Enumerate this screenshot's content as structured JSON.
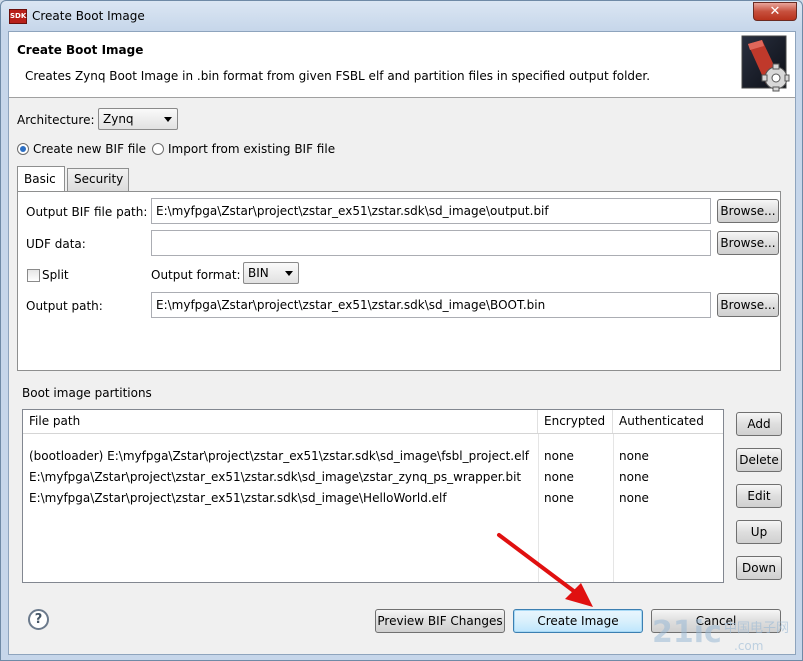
{
  "window": {
    "title": "Create Boot Image",
    "app_icon": "SDK",
    "close_glyph": "✕"
  },
  "banner": {
    "title": "Create Boot Image",
    "description": "Creates Zynq Boot Image in .bin format from given FSBL elf and partition files in specified output folder."
  },
  "architecture": {
    "label": "Architecture:",
    "value": "Zynq"
  },
  "mode": {
    "create_new": "Create new BIF file",
    "import_existing": "Import from existing BIF file",
    "selected": "create_new"
  },
  "tabs": [
    {
      "label": "Basic",
      "active": true
    },
    {
      "label": "Security",
      "active": false
    }
  ],
  "basic": {
    "output_bif_label": "Output BIF file path:",
    "output_bif_value": "E:\\myfpga\\Zstar\\project\\zstar_ex51\\zstar.sdk\\sd_image\\output.bif",
    "udf_label": "UDF data:",
    "udf_value": "",
    "split_label": "Split",
    "split_checked": false,
    "output_format_label": "Output format:",
    "output_format_value": "BIN",
    "output_path_label": "Output path:",
    "output_path_value": "E:\\myfpga\\Zstar\\project\\zstar_ex51\\zstar.sdk\\sd_image\\BOOT.bin",
    "browse_label": "Browse..."
  },
  "partitions": {
    "section_label": "Boot image partitions",
    "columns": [
      "File path",
      "Encrypted",
      "Authenticated"
    ],
    "rows": [
      {
        "path": "(bootloader) E:\\myfpga\\Zstar\\project\\zstar_ex51\\zstar.sdk\\sd_image\\fsbl_project.elf",
        "encrypted": "none",
        "authenticated": "none"
      },
      {
        "path": "E:\\myfpga\\Zstar\\project\\zstar_ex51\\zstar.sdk\\sd_image\\zstar_zynq_ps_wrapper.bit",
        "encrypted": "none",
        "authenticated": "none"
      },
      {
        "path": "E:\\myfpga\\Zstar\\project\\zstar_ex51\\zstar.sdk\\sd_image\\HelloWorld.elf",
        "encrypted": "none",
        "authenticated": "none"
      }
    ],
    "buttons": {
      "add": "Add",
      "delete": "Delete",
      "edit": "Edit",
      "up": "Up",
      "down": "Down"
    }
  },
  "footer": {
    "help_glyph": "?",
    "preview_label": "Preview BIF Changes",
    "create_label": "Create Image",
    "cancel_label": "Cancel"
  },
  "colors": {
    "accent": "#2d6fc3",
    "annotation_arrow": "#e01010"
  },
  "watermark": {
    "text": "21ic",
    "subtext": "中国电子网",
    "domain": ".com"
  }
}
